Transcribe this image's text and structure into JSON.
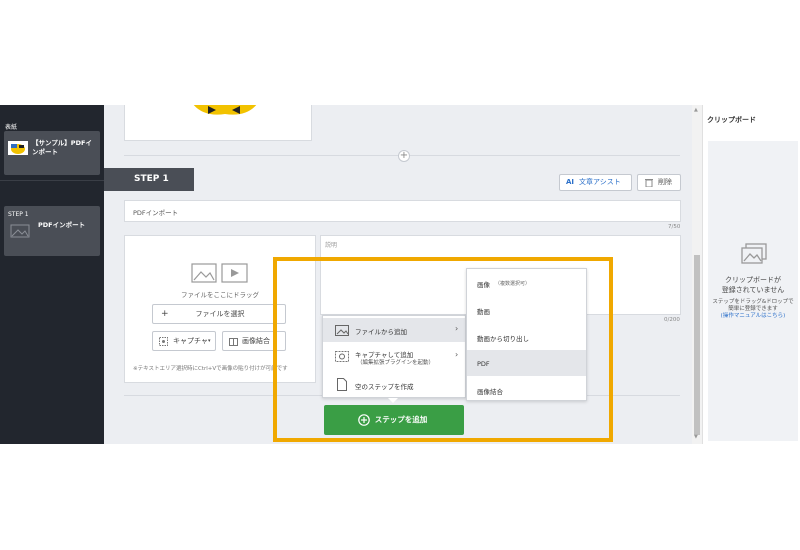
{
  "sidebar": {
    "cover_label": "表紙",
    "cover_title_line1": "【サンプル】PDFイ",
    "cover_title_line2": "ンポート",
    "step_label": "STEP 1",
    "step_title": "PDFインポート"
  },
  "editor": {
    "step_tab": "STEP 1",
    "ai_icon": "AI",
    "ai_assist_label": "文章アシスト",
    "delete_label": "削除",
    "title_value": "PDFインポート",
    "title_counter": "7/50",
    "media_drop_text": "ファイルをここにドラッグ",
    "select_file_label": "ファイルを選択",
    "capture_label": "キャプチャ",
    "image_merge_label": "画像結合",
    "paste_note": "※テキストエリア選択時にCtrl+Vで画像の貼り付けが可能です",
    "desc_placeholder": "説明",
    "desc_counter": "0/200"
  },
  "add_menu": {
    "items": [
      {
        "label": "ファイルから追加"
      },
      {
        "label": "キャプチャして追加",
        "sub": "（編集拡張プラグインを起動）"
      },
      {
        "label": "空のステップを作成"
      }
    ],
    "add_step_label": "ステップを追加"
  },
  "file_submenu": {
    "items": [
      {
        "label": "画像",
        "note": "（複数選択可）"
      },
      {
        "label": "動画"
      },
      {
        "label": "動画から切り出し"
      },
      {
        "label": "PDF"
      },
      {
        "label": "画像結合"
      }
    ]
  },
  "clipboard": {
    "title": "クリップボード",
    "empty_line1": "クリップボードが",
    "empty_line2": "登録されていません",
    "hint_line1": "ステップをドラッグ&ドロップで",
    "hint_line2": "簡単に登録できます",
    "manual_link": "(操作マニュアルはこちら)"
  },
  "colors": {
    "sidebar_bg": "#22262e",
    "accent_green": "#3a9e45",
    "highlight": "#f0a800",
    "link_blue": "#2a6fc9"
  }
}
